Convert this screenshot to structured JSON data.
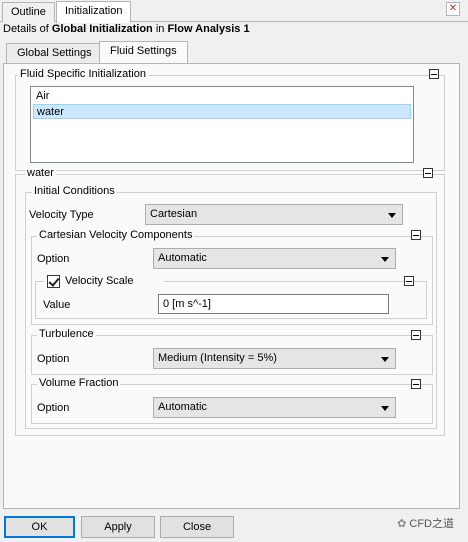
{
  "top_tabs": [
    "Outline",
    "Initialization"
  ],
  "details": {
    "prefix": "Details of ",
    "object": "Global Initialization",
    "middle": " in ",
    "context": "Flow Analysis 1"
  },
  "inner_tabs": [
    "Global Settings",
    "Fluid Settings"
  ],
  "fluid_init": {
    "title": "Fluid Specific Initialization",
    "fluids": [
      "Air",
      "water"
    ],
    "selected": "water"
  },
  "water_group": {
    "title": "water",
    "initial_conditions": {
      "title": "Initial Conditions",
      "velocity_type_label": "Velocity Type",
      "velocity_type_value": "Cartesian",
      "cartesian": {
        "title": "Cartesian Velocity Components",
        "option_label": "Option",
        "option_value": "Automatic",
        "velocity_scale": {
          "label": "Velocity Scale",
          "checked": true,
          "value_label": "Value",
          "value": "0 [m s^-1]"
        }
      },
      "turbulence": {
        "title": "Turbulence",
        "option_label": "Option",
        "option_value": "Medium (Intensity = 5%)"
      },
      "volume_fraction": {
        "title": "Volume Fraction",
        "option_label": "Option",
        "option_value": "Automatic"
      }
    }
  },
  "buttons": {
    "ok": "OK",
    "apply": "Apply",
    "close": "Close"
  },
  "watermark": "CFD之道",
  "colors": {
    "selection": "#cce8ff",
    "default_button_border": "#0078d7"
  }
}
